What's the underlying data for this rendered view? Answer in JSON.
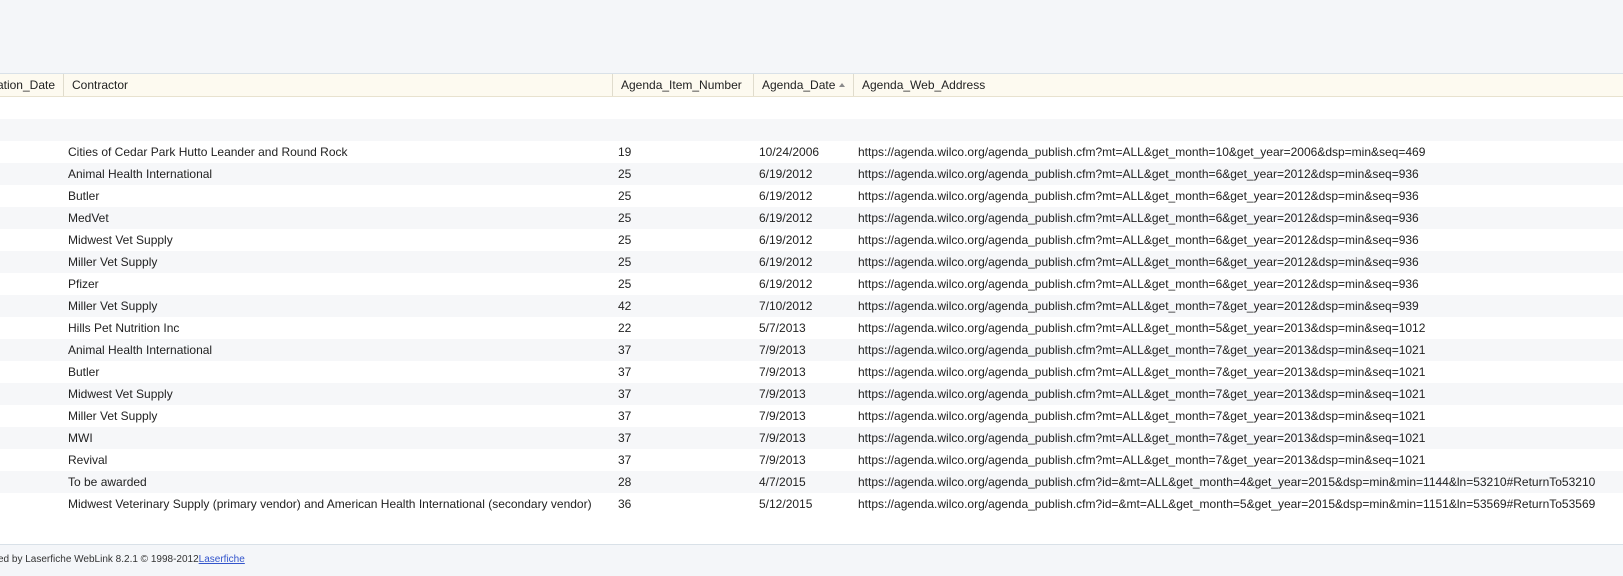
{
  "columns": {
    "date": "ation_Date",
    "contractor": "Contractor",
    "item_number": "Agenda_Item_Number",
    "agenda_date": "Agenda_Date",
    "web_address": "Agenda_Web_Address"
  },
  "rows": [
    {
      "contractor": "",
      "item": "",
      "date": "",
      "url": ""
    },
    {
      "contractor": "",
      "item": "",
      "date": "",
      "url": ""
    },
    {
      "contractor": "Cities of Cedar Park Hutto Leander and Round Rock",
      "item": "19",
      "date": "10/24/2006",
      "url": "https://agenda.wilco.org/agenda_publish.cfm?mt=ALL&get_month=10&get_year=2006&dsp=min&seq=469"
    },
    {
      "contractor": "Animal Health International",
      "item": "25",
      "date": "6/19/2012",
      "url": "https://agenda.wilco.org/agenda_publish.cfm?mt=ALL&get_month=6&get_year=2012&dsp=min&seq=936"
    },
    {
      "contractor": "Butler",
      "item": "25",
      "date": "6/19/2012",
      "url": "https://agenda.wilco.org/agenda_publish.cfm?mt=ALL&get_month=6&get_year=2012&dsp=min&seq=936"
    },
    {
      "contractor": "MedVet",
      "item": "25",
      "date": "6/19/2012",
      "url": "https://agenda.wilco.org/agenda_publish.cfm?mt=ALL&get_month=6&get_year=2012&dsp=min&seq=936"
    },
    {
      "contractor": "Midwest Vet Supply",
      "item": "25",
      "date": "6/19/2012",
      "url": "https://agenda.wilco.org/agenda_publish.cfm?mt=ALL&get_month=6&get_year=2012&dsp=min&seq=936"
    },
    {
      "contractor": "Miller Vet Supply",
      "item": "25",
      "date": "6/19/2012",
      "url": "https://agenda.wilco.org/agenda_publish.cfm?mt=ALL&get_month=6&get_year=2012&dsp=min&seq=936"
    },
    {
      "contractor": "Pfizer",
      "item": "25",
      "date": "6/19/2012",
      "url": "https://agenda.wilco.org/agenda_publish.cfm?mt=ALL&get_month=6&get_year=2012&dsp=min&seq=936"
    },
    {
      "contractor": "Miller Vet Supply",
      "item": "42",
      "date": "7/10/2012",
      "url": "https://agenda.wilco.org/agenda_publish.cfm?mt=ALL&get_month=7&get_year=2012&dsp=min&seq=939"
    },
    {
      "contractor": "Hills Pet Nutrition Inc",
      "item": "22",
      "date": "5/7/2013",
      "url": "https://agenda.wilco.org/agenda_publish.cfm?mt=ALL&get_month=5&get_year=2013&dsp=min&seq=1012"
    },
    {
      "contractor": "Animal Health International",
      "item": "37",
      "date": "7/9/2013",
      "url": "https://agenda.wilco.org/agenda_publish.cfm?mt=ALL&get_month=7&get_year=2013&dsp=min&seq=1021"
    },
    {
      "contractor": "Butler",
      "item": "37",
      "date": "7/9/2013",
      "url": "https://agenda.wilco.org/agenda_publish.cfm?mt=ALL&get_month=7&get_year=2013&dsp=min&seq=1021"
    },
    {
      "contractor": "Midwest Vet Supply",
      "item": "37",
      "date": "7/9/2013",
      "url": "https://agenda.wilco.org/agenda_publish.cfm?mt=ALL&get_month=7&get_year=2013&dsp=min&seq=1021"
    },
    {
      "contractor": "Miller Vet Supply",
      "item": "37",
      "date": "7/9/2013",
      "url": "https://agenda.wilco.org/agenda_publish.cfm?mt=ALL&get_month=7&get_year=2013&dsp=min&seq=1021"
    },
    {
      "contractor": "MWI",
      "item": "37",
      "date": "7/9/2013",
      "url": "https://agenda.wilco.org/agenda_publish.cfm?mt=ALL&get_month=7&get_year=2013&dsp=min&seq=1021"
    },
    {
      "contractor": "Revival",
      "item": "37",
      "date": "7/9/2013",
      "url": "https://agenda.wilco.org/agenda_publish.cfm?mt=ALL&get_month=7&get_year=2013&dsp=min&seq=1021"
    },
    {
      "contractor": "To be awarded",
      "item": "28",
      "date": "4/7/2015",
      "url": "https://agenda.wilco.org/agenda_publish.cfm?id=&mt=ALL&get_month=4&get_year=2015&dsp=min&min=1144&ln=53210#ReturnTo53210"
    },
    {
      "contractor": "Midwest Veterinary Supply (primary vendor) and American Health International (secondary vendor)",
      "item": "36",
      "date": "5/12/2015",
      "url": "https://agenda.wilco.org/agenda_publish.cfm?id=&mt=ALL&get_month=5&get_year=2015&dsp=min&min=1151&ln=53569#ReturnTo53569"
    }
  ],
  "footer": {
    "text": "ed by Laserfiche WebLink 8.2.1 © 1998-2012 ",
    "link": "Laserfiche"
  },
  "colors": {
    "header_bg": "#fdfaf0",
    "row_alt_bg": "#f6f7f9",
    "link": "#3355cc"
  }
}
